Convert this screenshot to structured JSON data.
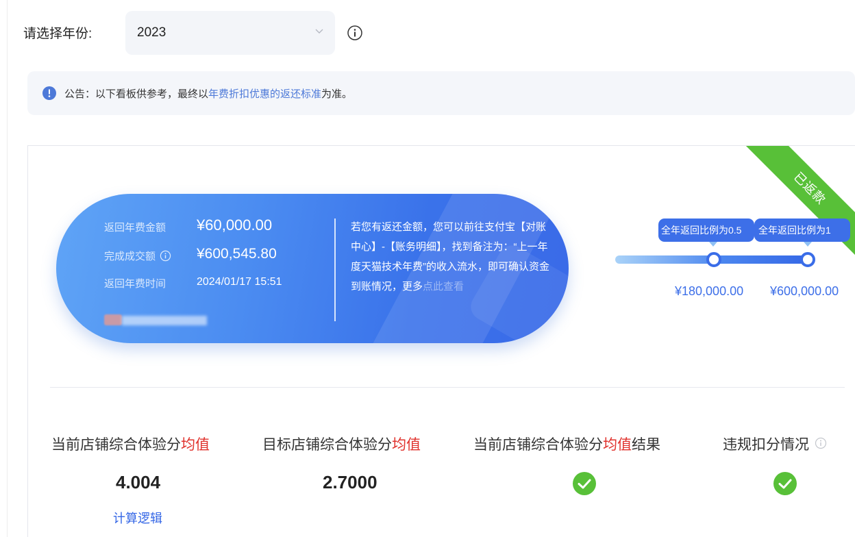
{
  "year_selector": {
    "label": "请选择年份:",
    "value": "2023"
  },
  "notice": {
    "prefix": "公告：以下看板供参考，最终以",
    "link": "年费折扣优惠的返还标准",
    "suffix": "为准。"
  },
  "status_ribbon": "已返款",
  "refund": {
    "amount_label": "返回年费金额",
    "amount_value": "¥60,000.00",
    "turnover_label": "完成成交额",
    "turnover_value": "¥600,545.80",
    "time_label": "返回年费时间",
    "time_value": "2024/01/17 15:51",
    "description": "若您有返还金额，您可以前往支付宝【对账中心】-【账务明细】，找到备注为：“上一年度天猫技术年费”的收入流水，即可确认资金到账情况，更多",
    "more_link": "点此查看"
  },
  "progress": {
    "milestones": [
      {
        "tag": "全年返回比例为0.5",
        "amount": "¥180,000.00"
      },
      {
        "tag": "全年返回比例为1",
        "amount": "¥600,000.00"
      }
    ]
  },
  "stats": {
    "current_score": {
      "label_prefix": "当前店铺综合体验分",
      "label_highlight": "均值",
      "value": "4.004",
      "link": "计算逻辑"
    },
    "target_score": {
      "label_prefix": "目标店铺综合体验分",
      "label_highlight": "均值",
      "value": "2.7000"
    },
    "score_result": {
      "label_prefix": "当前店铺综合体验分",
      "label_highlight": "均值",
      "label_suffix": "结果",
      "status": "passed"
    },
    "violation": {
      "label": "违规扣分情况",
      "status": "passed"
    }
  },
  "colors": {
    "accent": "#3a6de8",
    "success": "#58c038",
    "highlight": "#e0302b",
    "link": "#3567e6"
  }
}
